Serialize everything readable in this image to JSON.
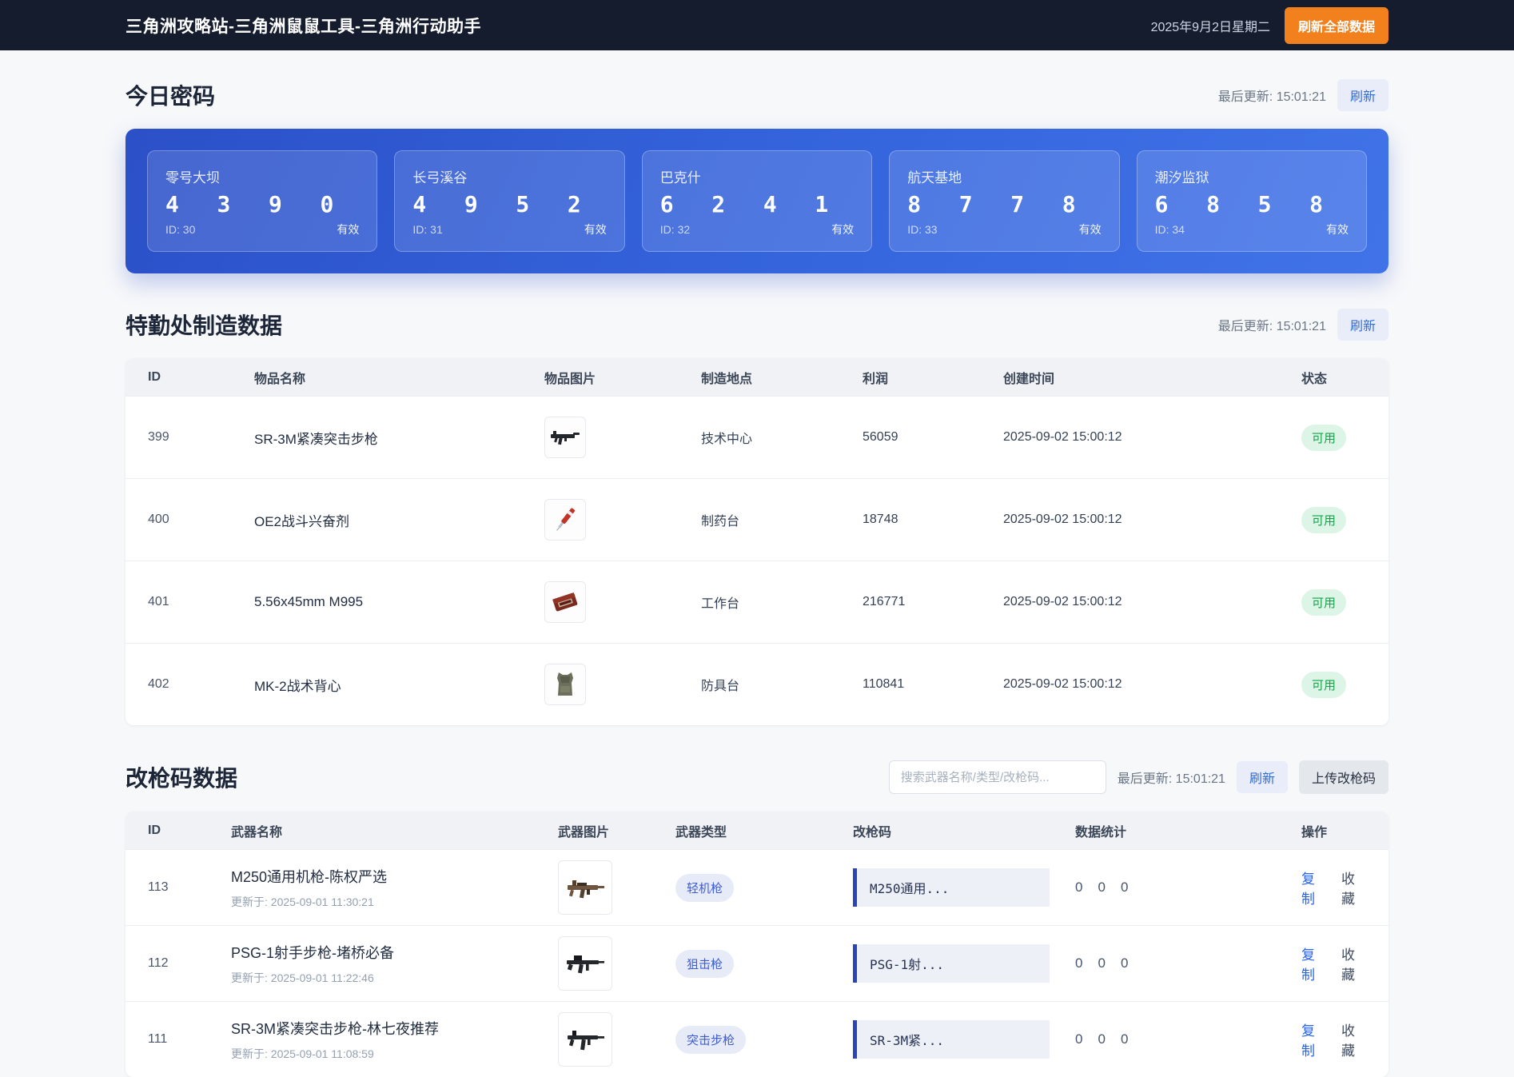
{
  "navbar": {
    "title": "三角洲攻略站-三角洲鼠鼠工具-三角洲行动助手",
    "date": "2025年9月2日星期二",
    "refresh_all_label": "刷新全部数据"
  },
  "password_section": {
    "title": "今日密码",
    "last_update": "最后更新: 15:01:21",
    "refresh_label": "刷新",
    "cards": [
      {
        "map": "零号大坝",
        "code": "4390",
        "id_label": "ID: 30",
        "status": "有效"
      },
      {
        "map": "长弓溪谷",
        "code": "4952",
        "id_label": "ID: 31",
        "status": "有效"
      },
      {
        "map": "巴克什",
        "code": "6241",
        "id_label": "ID: 32",
        "status": "有效"
      },
      {
        "map": "航天基地",
        "code": "8778",
        "id_label": "ID: 33",
        "status": "有效"
      },
      {
        "map": "潮汐监狱",
        "code": "6858",
        "id_label": "ID: 34",
        "status": "有效"
      }
    ]
  },
  "craft_section": {
    "title": "特勤处制造数据",
    "last_update": "最后更新: 15:01:21",
    "refresh_label": "刷新",
    "columns": [
      "ID",
      "物品名称",
      "物品图片",
      "制造地点",
      "利润",
      "创建时间",
      "状态"
    ],
    "rows": [
      {
        "id": "399",
        "name": "SR-3M紧凑突击步枪",
        "place": "技术中心",
        "profit": "56059",
        "created": "2025-09-02 15:00:12",
        "status": "可用",
        "icon": "rifle"
      },
      {
        "id": "400",
        "name": "OE2战斗兴奋剂",
        "place": "制药台",
        "profit": "18748",
        "created": "2025-09-02 15:00:12",
        "status": "可用",
        "icon": "stim"
      },
      {
        "id": "401",
        "name": "5.56x45mm M995",
        "place": "工作台",
        "profit": "216771",
        "created": "2025-09-02 15:00:12",
        "status": "可用",
        "icon": "ammo"
      },
      {
        "id": "402",
        "name": "MK-2战术背心",
        "place": "防具台",
        "profit": "110841",
        "created": "2025-09-02 15:00:12",
        "status": "可用",
        "icon": "vest"
      }
    ]
  },
  "mod_section": {
    "title": "改枪码数据",
    "search_placeholder": "搜索武器名称/类型/改枪码...",
    "last_update": "最后更新: 15:01:21",
    "refresh_label": "刷新",
    "upload_label": "上传改枪码",
    "columns": [
      "ID",
      "武器名称",
      "武器图片",
      "武器类型",
      "改枪码",
      "数据统计",
      "操作"
    ],
    "rows": [
      {
        "id": "113",
        "name": "M250通用机枪-陈权严选",
        "updated": "更新于: 2025-09-01 11:30:21",
        "type": "轻机枪",
        "code": "M250通用...",
        "stats": [
          "0",
          "0",
          "0"
        ],
        "copy": "复制",
        "fav": "收藏"
      },
      {
        "id": "112",
        "name": "PSG-1射手步枪-堵桥必备",
        "updated": "更新于: 2025-09-01 11:22:46",
        "type": "狙击枪",
        "code": "PSG-1射...",
        "stats": [
          "0",
          "0",
          "0"
        ],
        "copy": "复制",
        "fav": "收藏"
      },
      {
        "id": "111",
        "name": "SR-3M紧凑突击步枪-林七夜推荐",
        "updated": "更新于: 2025-09-01 11:08:59",
        "type": "突击步枪",
        "code": "SR-3M紧...",
        "stats": [
          "0",
          "0",
          "0"
        ],
        "copy": "复制",
        "fav": "收藏"
      }
    ]
  }
}
